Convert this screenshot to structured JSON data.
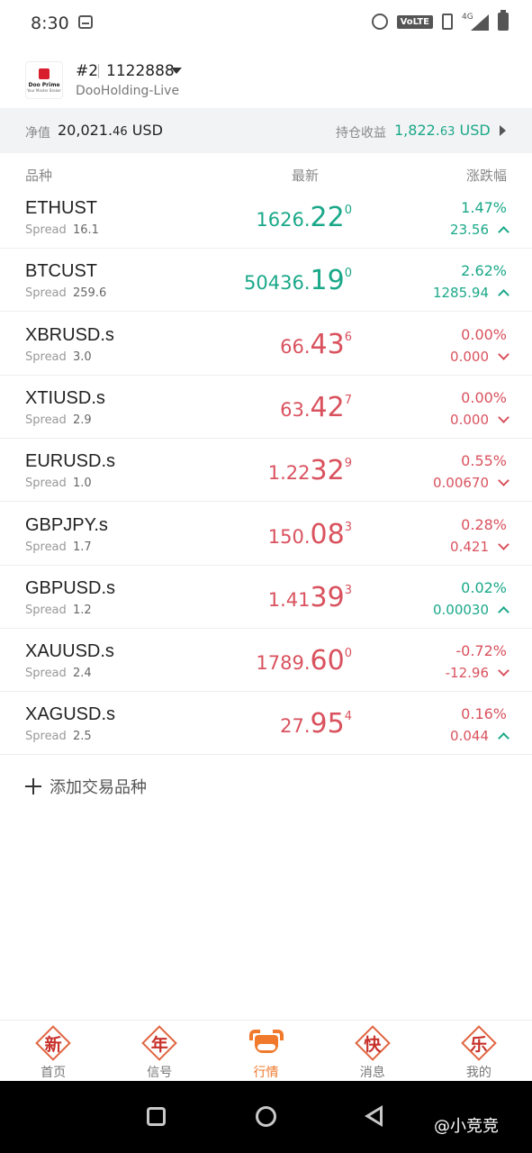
{
  "status_bar": {
    "time": "8:30",
    "icons": [
      "message-icon",
      "alarm-icon",
      "volte-icon",
      "vibrate-icon",
      "signal-4g-icon",
      "battery-icon"
    ],
    "volte_label": "VoLTE",
    "network_label": "4G"
  },
  "account": {
    "number": "#2",
    "id": "1122888",
    "server": "DooHolding-Live",
    "logo_text": "Doo Prime",
    "logo_sub": "Your Master Broker"
  },
  "equity": {
    "label": "净值",
    "value_main": "20,021.",
    "value_dec": "46",
    "currency": "USD",
    "pl_label": "持仓收益",
    "pl_main": "1,822.",
    "pl_dec": "63",
    "pl_currency": "USD"
  },
  "columns": {
    "symbol": "品种",
    "price": "最新",
    "change": "涨跌幅"
  },
  "spread_label": "Spread",
  "quotes": [
    {
      "symbol": "ETHUST",
      "spread": "16.1",
      "price_main": "1626.",
      "price_big": "22",
      "price_sup": "0",
      "pct": "1.47%",
      "change": "23.56",
      "trend": "up"
    },
    {
      "symbol": "BTCUST",
      "spread": "259.6",
      "price_main": "50436.",
      "price_big": "19",
      "price_sup": "0",
      "pct": "2.62%",
      "change": "1285.94",
      "trend": "up"
    },
    {
      "symbol": "XBRUSD.s",
      "spread": "3.0",
      "price_main": "66.",
      "price_big": "43",
      "price_sup": "6",
      "pct": "0.00%",
      "change": "0.000",
      "trend": "down"
    },
    {
      "symbol": "XTIUSD.s",
      "spread": "2.9",
      "price_main": "63.",
      "price_big": "42",
      "price_sup": "7",
      "pct": "0.00%",
      "change": "0.000",
      "trend": "down"
    },
    {
      "symbol": "EURUSD.s",
      "spread": "1.0",
      "price_main": "1.22",
      "price_big": "32",
      "price_sup": "9",
      "pct": "0.55%",
      "change": "0.00670",
      "trend": "down"
    },
    {
      "symbol": "GBPJPY.s",
      "spread": "1.7",
      "price_main": "150.",
      "price_big": "08",
      "price_sup": "3",
      "pct": "0.28%",
      "change": "0.421",
      "trend": "down"
    },
    {
      "symbol": "GBPUSD.s",
      "spread": "1.2",
      "price_main": "1.41",
      "price_big": "39",
      "price_sup": "3",
      "pct": "0.02%",
      "change": "0.00030",
      "trend": "up",
      "price_color": "down"
    },
    {
      "symbol": "XAUUSD.s",
      "spread": "2.4",
      "price_main": "1789.",
      "price_big": "60",
      "price_sup": "0",
      "pct": "-0.72%",
      "change": "-12.96",
      "trend": "down"
    },
    {
      "symbol": "XAGUSD.s",
      "spread": "2.5",
      "price_main": "27.",
      "price_big": "95",
      "price_sup": "4",
      "pct": "0.16%",
      "change": "0.044",
      "trend": "up",
      "price_color": "down",
      "text_color": "down"
    }
  ],
  "add_symbol_label": "添加交易品种",
  "nav": [
    {
      "icon_char": "新",
      "label": "首页",
      "icon": "new-year-diamond-icon",
      "active": false
    },
    {
      "icon_char": "年",
      "label": "信号",
      "icon": "new-year-diamond-icon",
      "active": false
    },
    {
      "icon_char": "",
      "label": "行情",
      "icon": "ox-icon",
      "active": true
    },
    {
      "icon_char": "快",
      "label": "消息",
      "icon": "new-year-diamond-icon",
      "active": false
    },
    {
      "icon_char": "乐",
      "label": "我的",
      "icon": "new-year-diamond-icon",
      "active": false
    }
  ],
  "watermark": "@小竞竞",
  "colors": {
    "up": "#1aa889",
    "down": "#d9525e",
    "accent": "#f0792b"
  }
}
